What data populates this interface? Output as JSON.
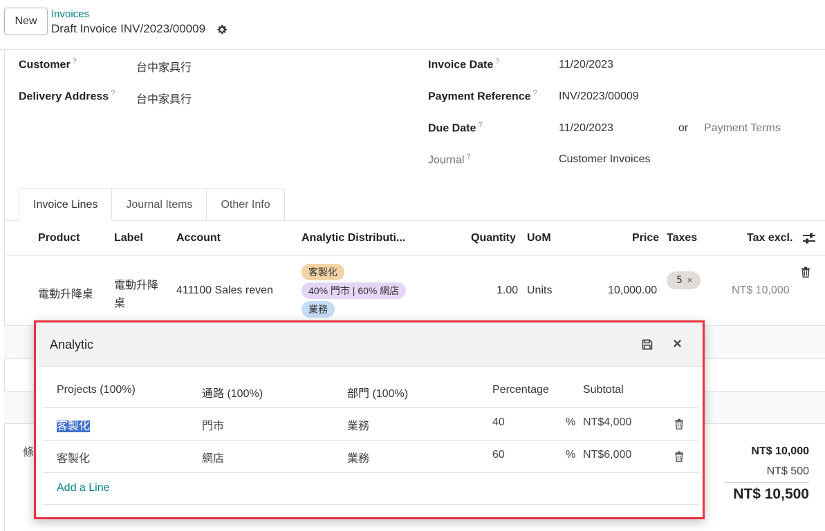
{
  "control_panel": {
    "new_label": "New",
    "breadcrumb_parent": "Invoices",
    "breadcrumb_current": "Draft Invoice INV/2023/00009",
    "settings_icon": "gear-icon"
  },
  "form": {
    "customer_label": "Customer",
    "customer_value": "台中家具行",
    "delivery_label": "Delivery Address",
    "delivery_value": "台中家具行",
    "help_mark": "?",
    "invoice_date_label": "Invoice Date",
    "invoice_date_value": "11/20/2023",
    "payment_ref_label": "Payment Reference",
    "payment_ref_value": "INV/2023/00009",
    "due_date_label": "Due Date",
    "due_date_value": "11/20/2023",
    "or_text": "or",
    "payment_terms_placeholder": "Payment Terms",
    "journal_label": "Journal",
    "journal_value": "Customer Invoices"
  },
  "tabs": [
    "Invoice Lines",
    "Journal Items",
    "Other Info"
  ],
  "lines_table": {
    "headers": {
      "product": "Product",
      "label": "Label",
      "account": "Account",
      "analytic": "Analytic Distributi...",
      "quantity": "Quantity",
      "uom": "UoM",
      "price": "Price",
      "taxes": "Taxes",
      "tax_excl": "Tax excl."
    },
    "row": {
      "product": "電動升降桌",
      "label_line1": "電動升降",
      "label_line2": "桌",
      "account": "411100 Sales reven",
      "analytic_tags": [
        "客製化",
        "40% 門市 | 60% 網店",
        "業務"
      ],
      "quantity": "1.00",
      "uom": "Units",
      "price": "10,000.00",
      "tax": "5",
      "tax_remove": "×",
      "subtotal": "NT$ 10,000"
    }
  },
  "terms_partial": "條",
  "totals": {
    "untaxed": "NT$ 10,000",
    "tax": "NT$ 500",
    "total": "NT$ 10,500"
  },
  "analytic_popup": {
    "title": "Analytic",
    "close": "×",
    "headers": {
      "projects": "Projects (100%)",
      "channel": "通路 (100%)",
      "department": "部門 (100%)",
      "percentage": "Percentage",
      "subtotal": "Subtotal"
    },
    "rows": [
      {
        "project": "客製化",
        "channel": "門市",
        "department": "業務",
        "percentage": "40",
        "pct_sign": "%",
        "subtotal": "NT$4,000"
      },
      {
        "project": "客製化",
        "channel": "網店",
        "department": "業務",
        "percentage": "60",
        "pct_sign": "%",
        "subtotal": "NT$6,000"
      }
    ],
    "add_line": "Add a Line"
  },
  "colors": {
    "accent": "#017e84",
    "highlight_border": "#e5333f",
    "tag_orange": "#f3d2a4",
    "tag_purple": "#e6d6f5",
    "tag_blue": "#c6dcf5"
  }
}
